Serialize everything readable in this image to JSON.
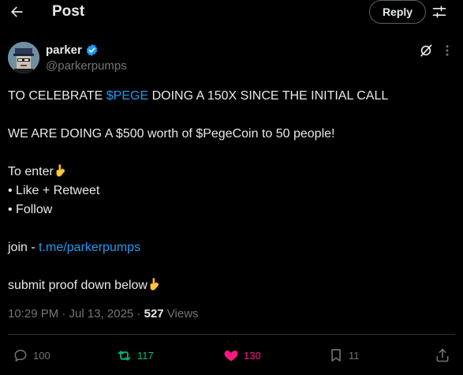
{
  "header": {
    "title": "Post",
    "reply_label": "Reply"
  },
  "author": {
    "name": "parker",
    "handle": "@parkerpumps"
  },
  "tweet": {
    "l1_pre": "TO CELEBRATE ",
    "l1_cashtag": "$PEGE",
    "l1_post": " DOING A 150X SINCE THE INITIAL CALL",
    "l2": "WE ARE DOING A $500 worth of $PegeCoin to 50 people!",
    "l3": "To enter",
    "l4": "• Like + Retweet",
    "l5": "• Follow",
    "l6_pre": "join - ",
    "l6_link": "t.me/parkerpumps",
    "l7": "submit proof down below"
  },
  "meta": {
    "time_date": "10:29 PM · Jul 13, 2025 · ",
    "views_count": "527",
    "views_label": " Views"
  },
  "actions": {
    "replies": "100",
    "reposts": "117",
    "likes": "130",
    "bookmarks": "11"
  },
  "colors": {
    "link": "#1d9bf0",
    "repost_active": "#00ba7c",
    "like_active": "#f91880",
    "muted": "#71767b"
  },
  "icons": [
    "back-arrow-icon",
    "filter-icon",
    "verified-badge-icon",
    "grok-icon",
    "more-icon",
    "pointing-down-emoji",
    "reply-icon",
    "repost-icon",
    "like-icon",
    "bookmark-icon",
    "share-icon"
  ]
}
